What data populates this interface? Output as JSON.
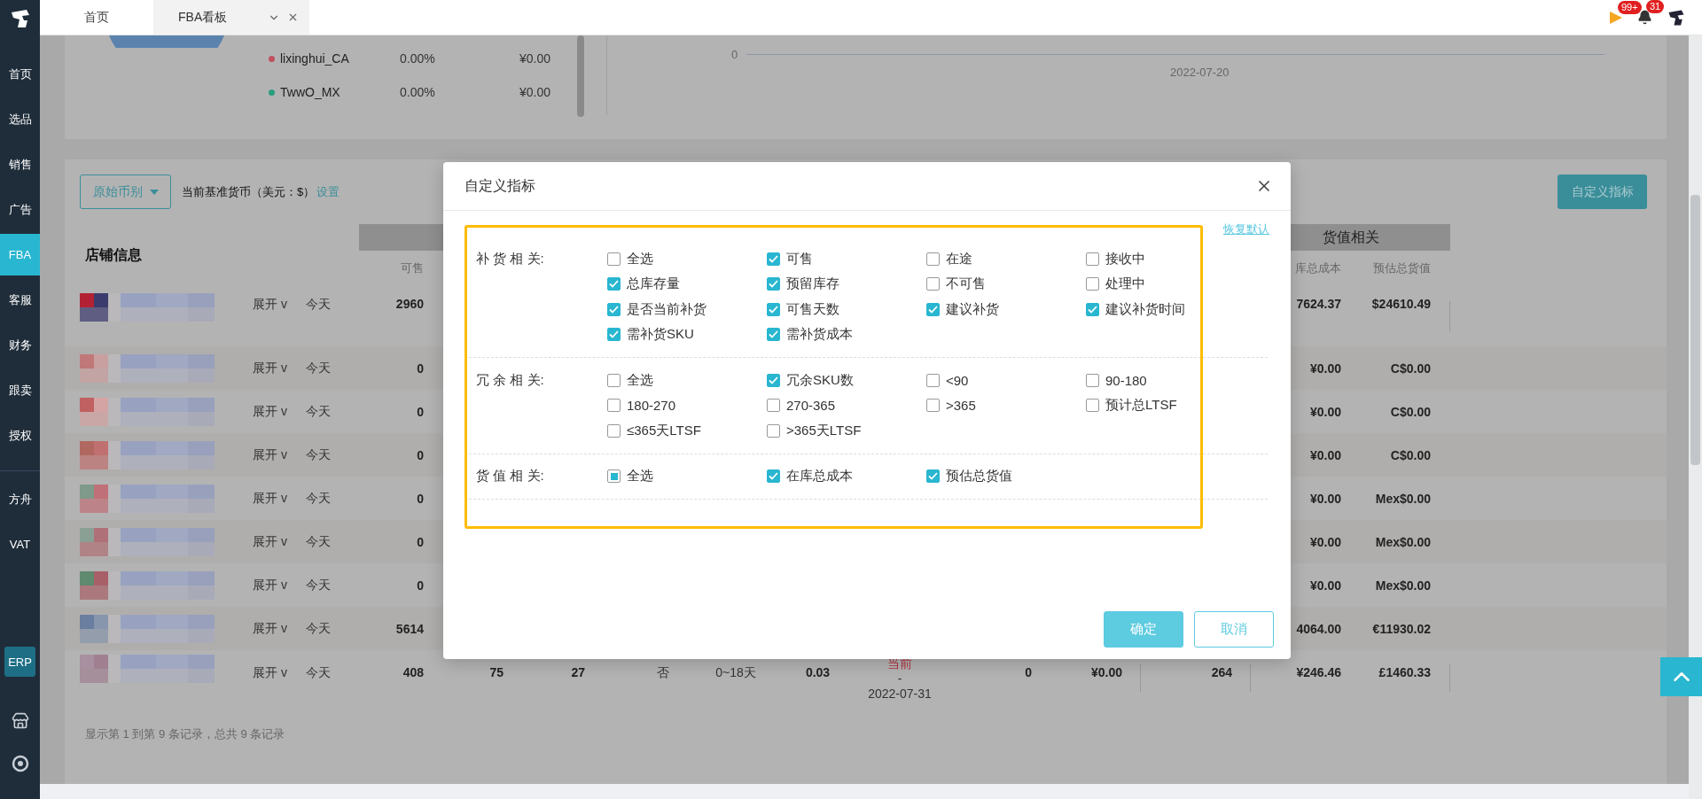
{
  "sidebar": {
    "items": [
      {
        "label": "首页",
        "selected": false
      },
      {
        "label": "选品",
        "selected": false
      },
      {
        "label": "销售",
        "selected": false
      },
      {
        "label": "广告",
        "selected": false
      },
      {
        "label": "FBA",
        "selected": true
      },
      {
        "label": "客服",
        "selected": false
      },
      {
        "label": "财务",
        "selected": false
      },
      {
        "label": "跟卖",
        "selected": false
      },
      {
        "label": "授权",
        "selected": false
      }
    ],
    "tools": [
      {
        "label": "方舟",
        "selected": false
      },
      {
        "label": "VAT",
        "selected": false
      }
    ],
    "erp_badge": "ERP"
  },
  "tabs": [
    {
      "label": "首页",
      "selected": false,
      "closable": false
    },
    {
      "label": "FBA看板",
      "selected": true,
      "closable": true
    }
  ],
  "header_icons": {
    "flag_badge": "99+",
    "bell_badge": "31"
  },
  "overview": {
    "legend": [
      {
        "name": "lixinghui_CA",
        "share": "0.00%",
        "amount": "¥0.00",
        "color": "#c0505f"
      },
      {
        "name": "TwwO_MX",
        "share": "0.00%",
        "amount": "¥0.00",
        "color": "#2a9d80"
      }
    ],
    "trend": {
      "y_label": "0",
      "x_label": "2022-07-20"
    }
  },
  "toolbar": {
    "currency_select": "原始币别",
    "base_currency": "当前基准货币（美元：$）",
    "settings_link": "设置",
    "customize_button": "自定义指标"
  },
  "table": {
    "store_header": "店铺信息",
    "group_header": "货值相关",
    "columns": [
      {
        "label": "可售"
      },
      {
        "label": "库总成本"
      },
      {
        "label": "预估总货值"
      }
    ],
    "rows": [
      {
        "expand": "展开 v",
        "day": "今天",
        "available": "2960",
        "stock_cost": "7624.37",
        "estimated_value": "$24610.49"
      },
      {
        "expand": "展开 v",
        "day": "今天",
        "available": "0",
        "stock_cost": "¥0.00",
        "estimated_value": "C$0.00"
      },
      {
        "expand": "展开 v",
        "day": "今天",
        "available": "0",
        "stock_cost": "¥0.00",
        "estimated_value": "C$0.00"
      },
      {
        "expand": "展开 v",
        "day": "今天",
        "available": "0",
        "stock_cost": "¥0.00",
        "estimated_value": "C$0.00"
      },
      {
        "expand": "展开 v",
        "day": "今天",
        "available": "0",
        "stock_cost": "¥0.00",
        "estimated_value": "Mex$0.00"
      },
      {
        "expand": "展开 v",
        "day": "今天",
        "available": "0",
        "stock_cost": "¥0.00",
        "estimated_value": "Mex$0.00"
      },
      {
        "expand": "展开 v",
        "day": "今天",
        "available": "0",
        "stock_cost": "¥0.00",
        "estimated_value": "Mex$0.00"
      },
      {
        "expand": "展开 v",
        "day": "今天",
        "available": "5614",
        "stock_cost": "4064.00",
        "estimated_value": "€11930.02"
      },
      {
        "expand": "展开 v",
        "day": "今天",
        "available": "408",
        "column_5": "75",
        "column_6": "27",
        "column_7": "否",
        "column_8": "0~18天",
        "column_9": "0.03",
        "column_10": {
          "status": "当前",
          "separator": "-",
          "date": "2022-07-31"
        },
        "column_11": "0",
        "column_12": "¥0.00",
        "column_13": "264",
        "stock_cost": "¥246.46",
        "estimated_value": "£1460.33"
      }
    ],
    "footer": "显示第 1 到第 9 条记录，总共 9 条记录"
  },
  "modal": {
    "title": "自定义指标",
    "restore_link": "恢复默认",
    "sections": [
      {
        "label": "补 货 相 关:",
        "select_all": {
          "label": "全选",
          "checked": false,
          "indeterminate": false
        },
        "options": [
          {
            "label": "可售",
            "checked": true
          },
          {
            "label": "在途",
            "checked": false
          },
          {
            "label": "接收中",
            "checked": false
          },
          {
            "label": "总库存量",
            "checked": true
          },
          {
            "label": "预留库存",
            "checked": true
          },
          {
            "label": "不可售",
            "checked": false
          },
          {
            "label": "处理中",
            "checked": false
          },
          {
            "label": "是否当前补货",
            "checked": true
          },
          {
            "label": "可售天数",
            "checked": true
          },
          {
            "label": "建议补货",
            "checked": true
          },
          {
            "label": "建议补货时间",
            "checked": true
          },
          {
            "label": "需补货SKU",
            "checked": true
          },
          {
            "label": "需补货成本",
            "checked": true
          }
        ]
      },
      {
        "label": "冗 余 相 关:",
        "select_all": {
          "label": "全选",
          "checked": false,
          "indeterminate": false
        },
        "options": [
          {
            "label": "冗余SKU数",
            "checked": true
          },
          {
            "label": "<90",
            "checked": false
          },
          {
            "label": "90-180",
            "checked": false
          },
          {
            "label": "180-270",
            "checked": false
          },
          {
            "label": "270-365",
            "checked": false
          },
          {
            "label": ">365",
            "checked": false
          },
          {
            "label": "预计总LTSF",
            "checked": false
          },
          {
            "label": "≤365天LTSF",
            "checked": false
          },
          {
            "label": ">365天LTSF",
            "checked": false
          }
        ]
      },
      {
        "label": "货 值 相 关:",
        "select_all": {
          "label": "全选",
          "checked": false,
          "indeterminate": true
        },
        "options": [
          {
            "label": "在库总成本",
            "checked": true
          },
          {
            "label": "预估总货值",
            "checked": true
          }
        ]
      }
    ],
    "buttons": [
      {
        "label": "确定",
        "kind": "primary"
      },
      {
        "label": "取消",
        "kind": "secondary"
      }
    ]
  }
}
